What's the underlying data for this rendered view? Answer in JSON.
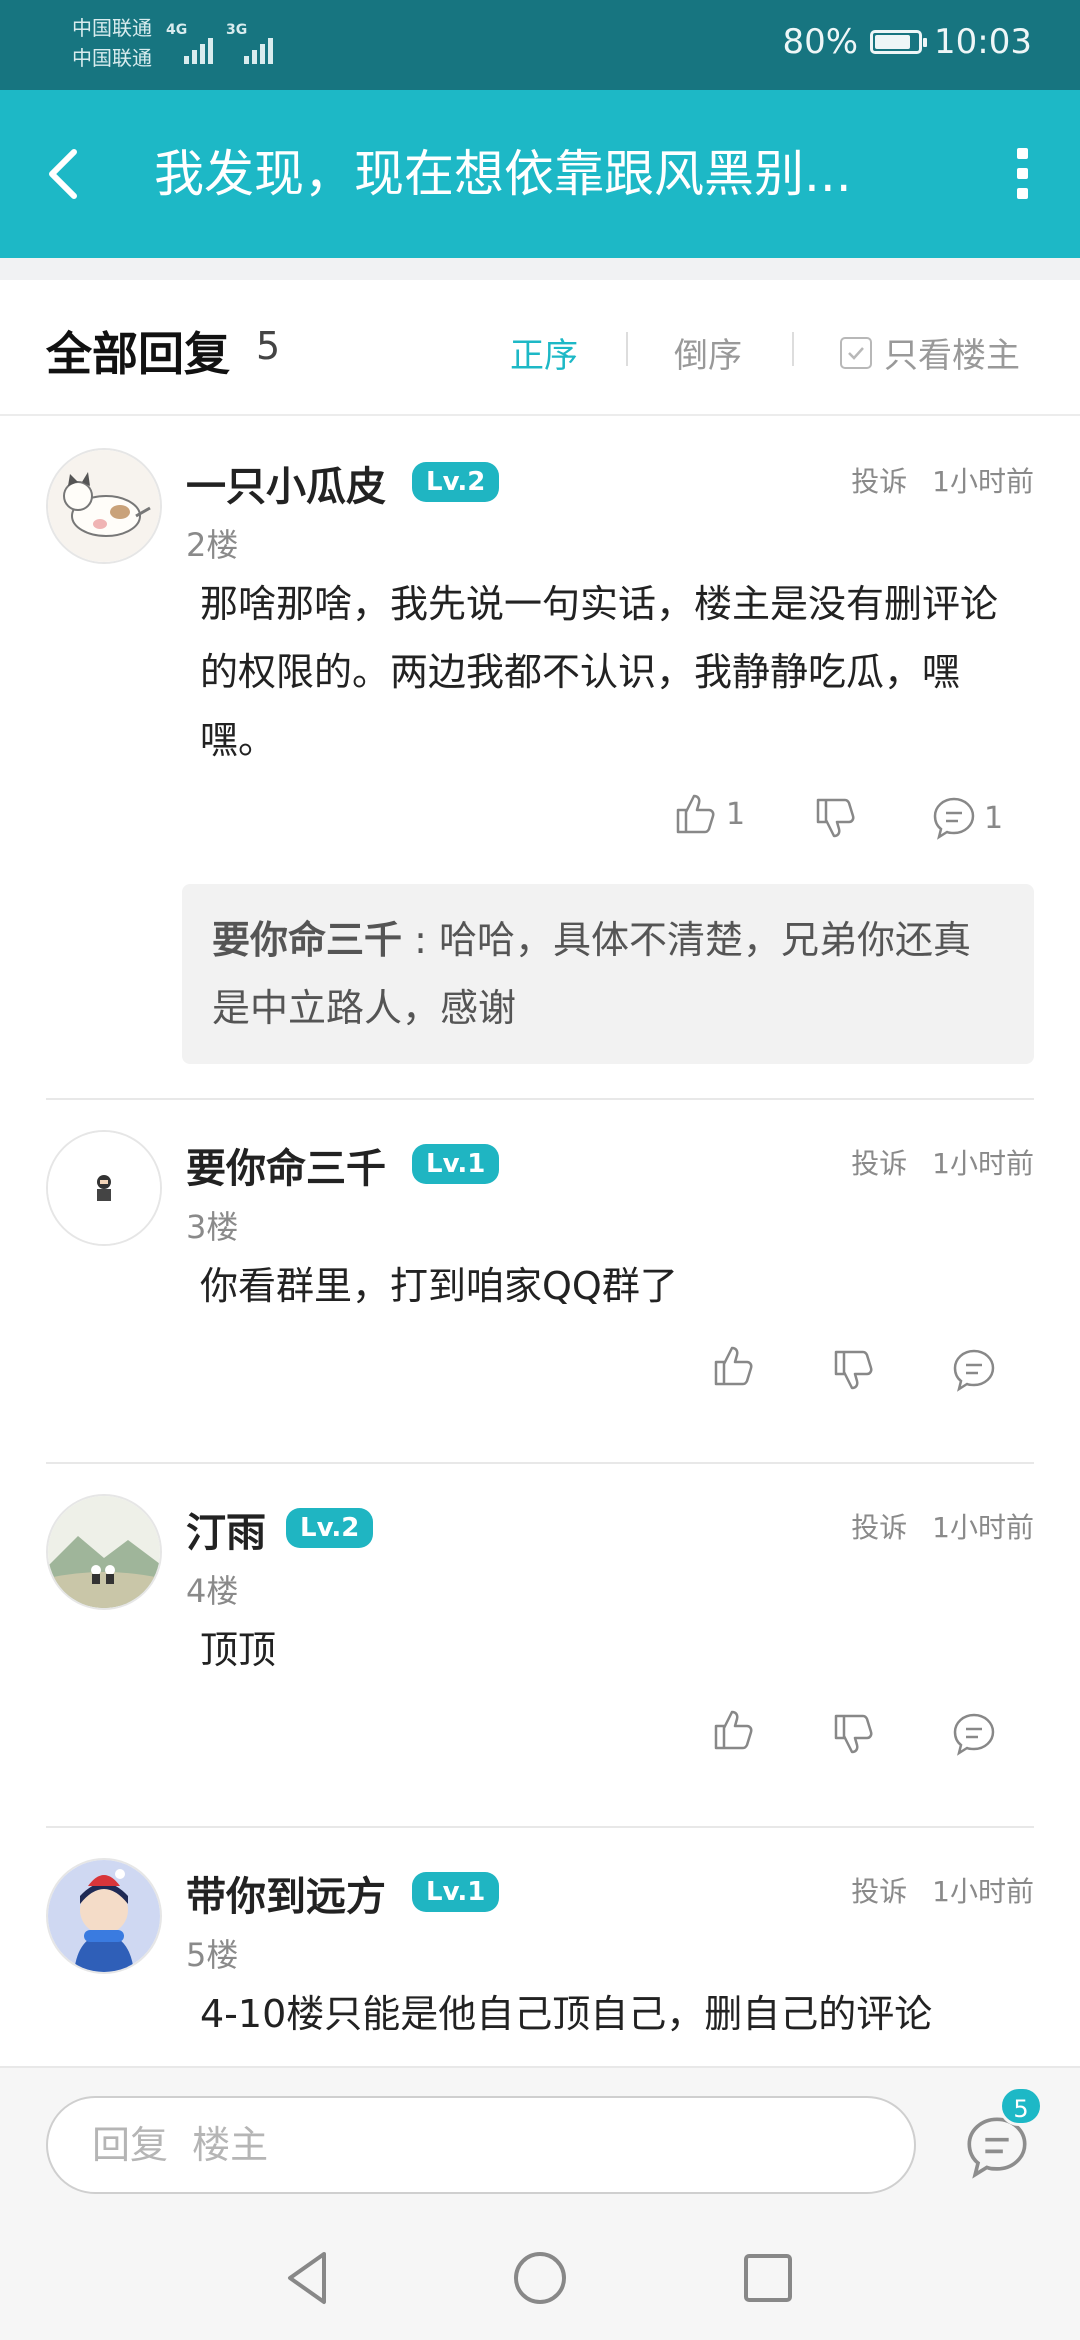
{
  "status_bar": {
    "carrier1": "中国联通",
    "carrier2": "中国联通",
    "net1": "4G",
    "net2": "3G",
    "battery": "80%",
    "battery_level": 0.8,
    "time": "10:03"
  },
  "app_bar": {
    "title": "我发现，现在想依靠跟风黑别..."
  },
  "reply_header": {
    "title": "全部回复",
    "count": "5",
    "sort_asc": "正序",
    "sort_desc": "倒序",
    "only_op": "只看楼主"
  },
  "comments": [
    {
      "username": "一只小瓜皮",
      "level": "Lv.2",
      "floor": "2楼",
      "report": "投诉",
      "time": "1小时前",
      "text": "那啥那啥，我先说一句实话，楼主是没有删评论的权限的。两边我都不认识，我静静吃瓜，嘿嘿。",
      "likes": "1",
      "replies": "1",
      "sub_reply": {
        "author": "要你命三千",
        "separator": ":",
        "text": "哈哈，具体不清楚，兄弟你还真是中立路人，感谢"
      }
    },
    {
      "username": "要你命三千",
      "level": "Lv.1",
      "floor": "3楼",
      "report": "投诉",
      "time": "1小时前",
      "text": "你看群里，打到咱家QQ群了"
    },
    {
      "username": "汀雨",
      "level": "Lv.2",
      "floor": "4楼",
      "report": "投诉",
      "time": "1小时前",
      "text": "顶顶"
    },
    {
      "username": "带你到远方",
      "level": "Lv.1",
      "floor": "5楼",
      "report": "投诉",
      "time": "1小时前",
      "text": "4-10楼只能是他自己顶自己，删自己的评论"
    }
  ],
  "input_bar": {
    "placeholder": "回复  楼主",
    "comment_badge": "5"
  },
  "colors": {
    "accent": "#1db8c6",
    "status_bar": "#177580"
  }
}
